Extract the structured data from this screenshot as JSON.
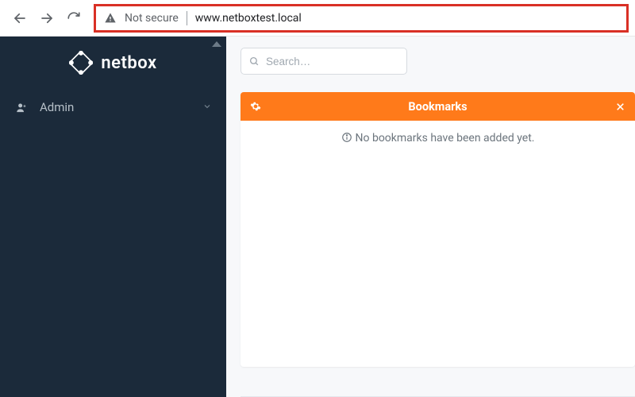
{
  "browser": {
    "security_label": "Not secure",
    "url": "www.netboxtest.local"
  },
  "sidebar": {
    "brand": "netbox",
    "items": [
      {
        "icon": "user-icon",
        "label": "Admin"
      }
    ]
  },
  "search": {
    "placeholder": "Search…"
  },
  "bookmarks_card": {
    "title": "Bookmarks",
    "empty_message": "No bookmarks have been added yet."
  },
  "colors": {
    "sidebar_bg": "#1b2a3a",
    "accent": "#ff7a1a",
    "highlight_border": "#d93025"
  }
}
